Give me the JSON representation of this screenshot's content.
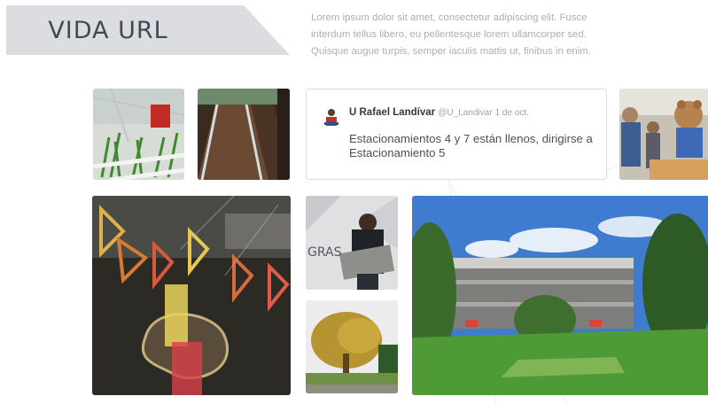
{
  "header": {
    "title": "VIDA URL",
    "intro": "Lorem ipsum dolor sit amet, consectetur adipiscing elit. Fusce interdum tellus libero, eu pellentesque lorem ullamcorper sed. Quisque augue turpis, semper iaculis mattis ut, finibus in enim."
  },
  "tweet": {
    "author": "U Rafael Landívar",
    "handle": "@U_Landivar",
    "date": "1 de oct.",
    "text": "Estacionamientos 4 y 7 están llenos, dirigirse a Estacionamiento 5"
  },
  "photos": {
    "tile_1": "greenhouse-icon",
    "tile_2": "garden-rows-icon",
    "tile_3": "market-teddy-bear-icon",
    "tile_4": "light-installation-icon",
    "tile_5": "gras-poster-person-icon",
    "tile_6": "tree-icon",
    "tile_7": "campus-building-icon",
    "poster_text": "GRAS"
  },
  "colors": {
    "banner": "#dcdde0",
    "title_text": "#3f4a55",
    "intro_text": "#a9aeb8",
    "tweet_border": "#d9dce0"
  }
}
